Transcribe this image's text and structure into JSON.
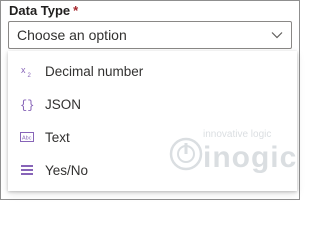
{
  "field": {
    "label": "Data Type",
    "required_marker": "*"
  },
  "select": {
    "value": "Choose an option",
    "chevron_icon": "chevron-down-icon"
  },
  "options": [
    {
      "label": "Decimal number",
      "icon": "decimal-number-icon"
    },
    {
      "label": "JSON",
      "icon": "json-braces-icon"
    },
    {
      "label": "Text",
      "icon": "text-abc-icon"
    },
    {
      "label": "Yes/No",
      "icon": "yes-no-list-icon"
    }
  ],
  "watermark": {
    "tagline": "innovative logic",
    "brand": "inogic"
  },
  "colors": {
    "required": "#a4262c",
    "icon_purple": "#8764b8",
    "text": "#323130",
    "border": "#8a8886"
  }
}
